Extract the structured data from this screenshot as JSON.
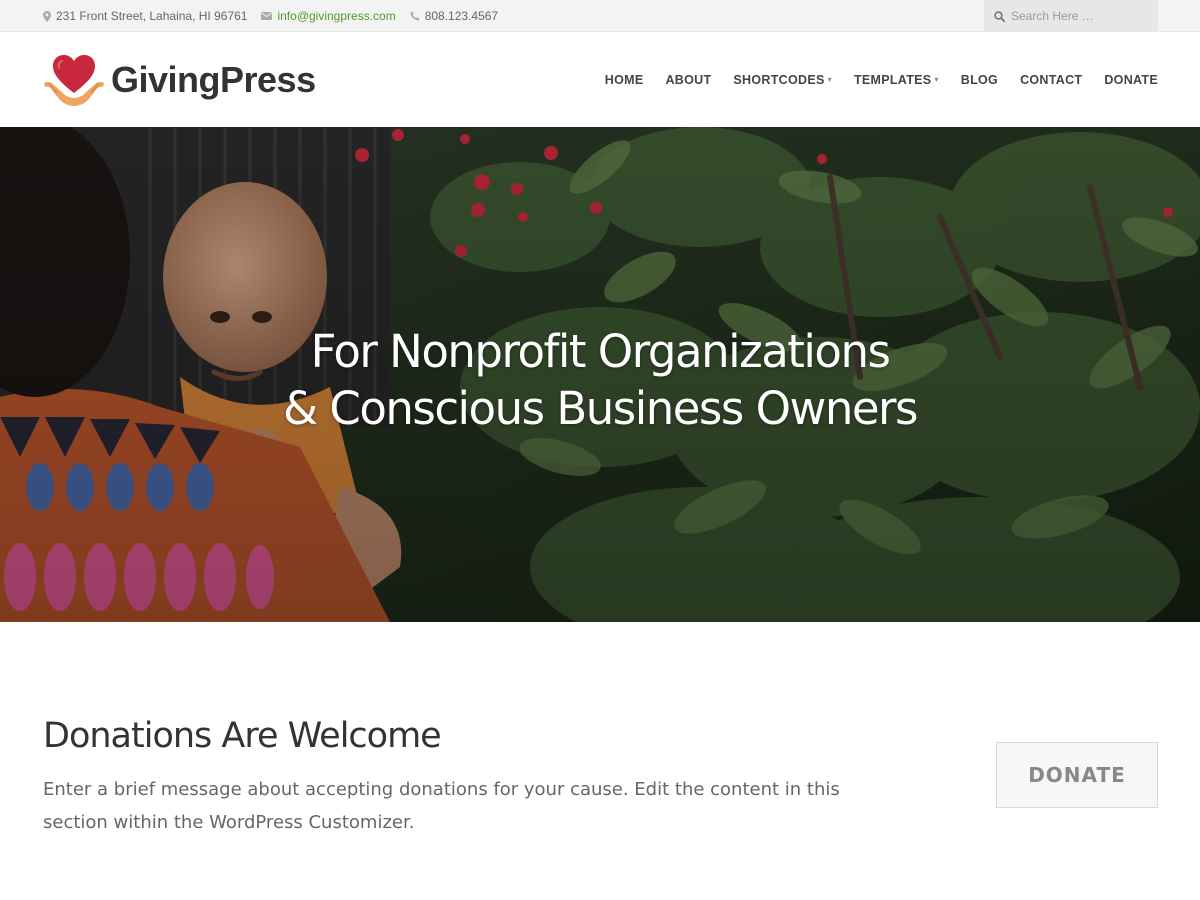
{
  "topbar": {
    "address": "231 Front Street, Lahaina, HI 96761",
    "email": "info@givingpress.com",
    "phone": "808.123.4567",
    "search_placeholder": "Search Here …",
    "icons": [
      "map-pin-icon",
      "envelope-icon",
      "phone-icon",
      "search-icon"
    ]
  },
  "brand": {
    "name": "GivingPress",
    "logo_icon": "heart-hands-icon",
    "colors": {
      "heart": "#c8283c",
      "hands": "#f0a45f",
      "email_link": "#4e9a2f"
    }
  },
  "nav": {
    "items": [
      {
        "label": "HOME",
        "has_submenu": false
      },
      {
        "label": "ABOUT",
        "has_submenu": false
      },
      {
        "label": "SHORTCODES",
        "has_submenu": true
      },
      {
        "label": "TEMPLATES",
        "has_submenu": true
      },
      {
        "label": "BLOG",
        "has_submenu": false
      },
      {
        "label": "CONTACT",
        "has_submenu": false
      },
      {
        "label": "DONATE",
        "has_submenu": false
      }
    ]
  },
  "hero": {
    "title_line1": "For Nonprofit Organizations",
    "title_line2": "& Conscious Business Owners"
  },
  "donations": {
    "title": "Donations Are Welcome",
    "text": "Enter a brief message about accepting donations for your cause. Edit the content in this section within the WordPress Customizer.",
    "button_label": "DONATE"
  }
}
